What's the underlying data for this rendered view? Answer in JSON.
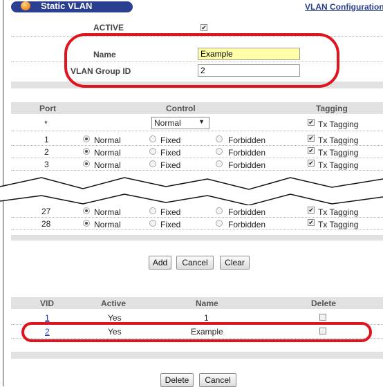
{
  "header": {
    "title": "Static VLAN",
    "nav_link": "VLAN Configuration"
  },
  "form": {
    "active_label": "ACTIVE",
    "active_checked": true,
    "name_label": "Name",
    "name_value": "Example",
    "group_label": "VLAN Group ID",
    "group_value": "2"
  },
  "port_table": {
    "headers": {
      "port": "Port",
      "control": "Control",
      "tagging": "Tagging"
    },
    "all_row": {
      "port": "*",
      "control_selected": "Normal",
      "tagging_label": "Tx Tagging"
    },
    "options": {
      "normal": "Normal",
      "fixed": "Fixed",
      "forbidden": "Forbidden",
      "tx": "Tx Tagging"
    },
    "rows": [
      {
        "port": "1",
        "control": "Normal",
        "tx_tagging": true
      },
      {
        "port": "2",
        "control": "Normal",
        "tx_tagging": true
      },
      {
        "port": "3",
        "control": "Normal",
        "tx_tagging": true
      },
      {
        "port": "27",
        "control": "Normal",
        "tx_tagging": true
      },
      {
        "port": "28",
        "control": "Normal",
        "tx_tagging": true
      }
    ]
  },
  "actions": {
    "add": "Add",
    "cancel": "Cancel",
    "clear": "Clear"
  },
  "vlan_table": {
    "headers": {
      "vid": "VID",
      "active": "Active",
      "name": "Name",
      "delete": "Delete"
    },
    "rows": [
      {
        "vid": "1",
        "active": "Yes",
        "name": "1"
      },
      {
        "vid": "2",
        "active": "Yes",
        "name": "Example"
      }
    ]
  },
  "bottom_actions": {
    "delete": "Delete",
    "cancel": "Cancel"
  },
  "colors": {
    "header_bg": "#2a3f8f",
    "highlight": "#e0141e",
    "name_field_bg": "#ffffa8",
    "band": "#e1e1e1"
  }
}
